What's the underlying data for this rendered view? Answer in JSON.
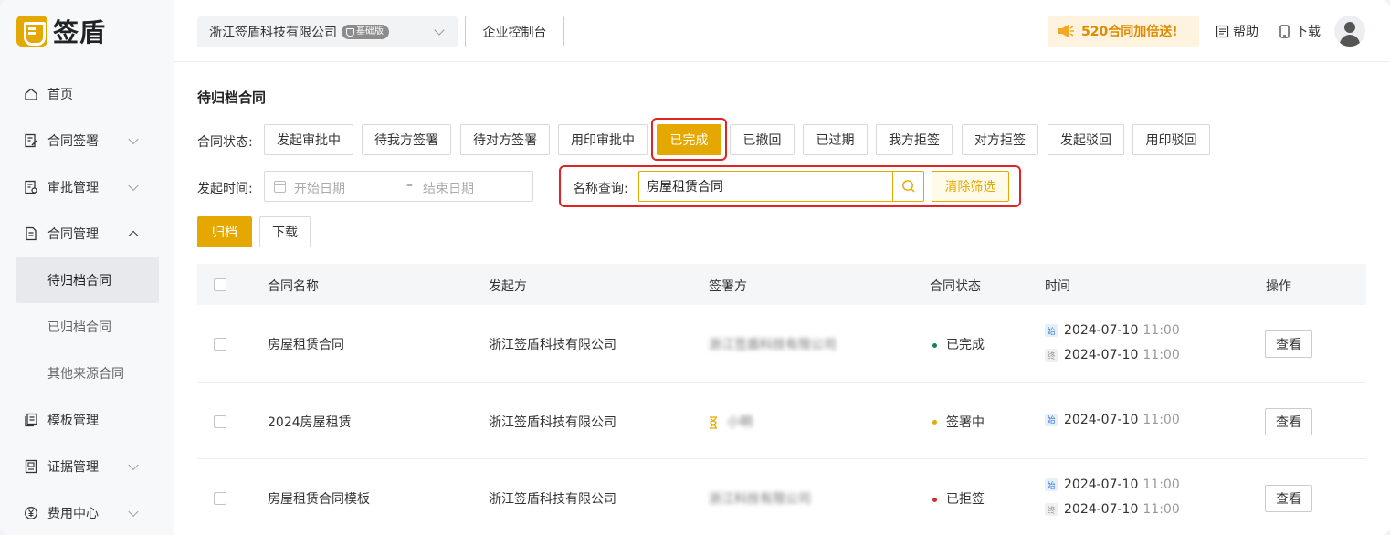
{
  "brand": {
    "name": "签盾",
    "accent": "#e5a800"
  },
  "header": {
    "company": "浙江签盾科技有限公司",
    "edition_badge": "基础版",
    "console_label": "企业控制台",
    "promo": "520合同加倍送!",
    "help_label": "帮助",
    "download_label": "下载"
  },
  "sidebar": {
    "items": [
      {
        "label": "首页",
        "icon": "home-icon"
      },
      {
        "label": "合同签署",
        "icon": "contract-sign-icon"
      },
      {
        "label": "审批管理",
        "icon": "approval-icon"
      },
      {
        "label": "合同管理",
        "icon": "contract-manage-icon"
      },
      {
        "label": "模板管理",
        "icon": "template-icon"
      },
      {
        "label": "证据管理",
        "icon": "evidence-icon"
      },
      {
        "label": "费用中心",
        "icon": "fee-icon"
      }
    ],
    "sub_items": [
      "待归档合同",
      "已归档合同",
      "其他来源合同"
    ]
  },
  "page": {
    "title": "待归档合同",
    "status_label": "合同状态:",
    "statuses": [
      "发起审批中",
      "待我方签署",
      "待对方签署",
      "用印审批中",
      "已完成",
      "已撤回",
      "已过期",
      "我方拒签",
      "对方拒签",
      "发起驳回",
      "用印驳回"
    ],
    "active_status": "已完成",
    "time_label": "发起时间:",
    "date_start_placeholder": "开始日期",
    "date_end_placeholder": "结束日期",
    "date_separator": "–",
    "name_query_label": "名称查询:",
    "name_query_value": "房屋租赁合同",
    "clear_label": "清除筛选",
    "archive_label": "归档",
    "download_label": "下载"
  },
  "table": {
    "headers": [
      "合同名称",
      "发起方",
      "签署方",
      "合同状态",
      "时间",
      "操作"
    ],
    "rows": [
      {
        "name": "房屋租赁合同",
        "initiator": "浙江签盾科技有限公司",
        "signer": "浙江签盾科技有限公司",
        "status": "已完成",
        "status_color": "#1a7f5a",
        "start_tag": "始",
        "start_date": "2024-07-10",
        "start_time": "11:00",
        "end_tag": "终",
        "end_date": "2024-07-10",
        "end_time": "11:00",
        "action": "查看"
      },
      {
        "name": "2024房屋租赁",
        "initiator": "浙江签盾科技有限公司",
        "signer": "小明",
        "status": "签署中",
        "status_color": "#e5a800",
        "start_tag": "始",
        "start_date": "2024-07-10",
        "start_time": "11:00",
        "action": "查看"
      },
      {
        "name": "房屋租赁合同模板",
        "initiator": "浙江签盾科技有限公司",
        "signer": "浙江科技有限公司",
        "status": "已拒签",
        "status_color": "#d32f2f",
        "start_tag": "始",
        "start_date": "2024-07-10",
        "start_time": "11:00",
        "end_tag": "终",
        "end_date": "2024-07-10",
        "end_time": "11:00",
        "action": "查看"
      }
    ]
  }
}
